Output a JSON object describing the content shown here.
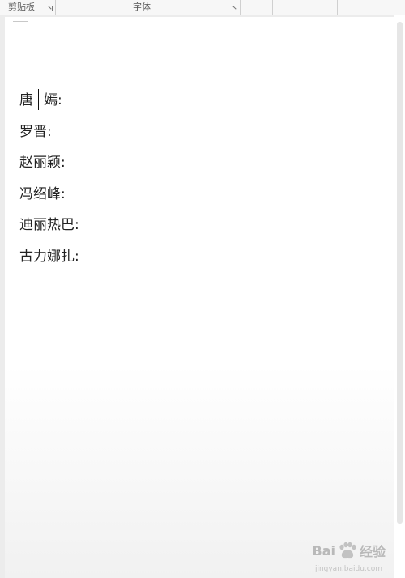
{
  "ribbon": {
    "clipboard_group": "剪贴板",
    "font_group": "字体"
  },
  "document": {
    "lines": [
      "唐嫣:",
      "罗晋:",
      "赵丽颖:",
      "冯绍峰:",
      "迪丽热巴:",
      "古力娜扎:"
    ],
    "first_line_before_cursor": "唐",
    "first_line_after_cursor": "嫣:"
  },
  "watermark": {
    "brand": "Bai",
    "suffix": "经验",
    "url": "jingyan.baidu.com",
    "icon": "baidu-paw-icon"
  }
}
